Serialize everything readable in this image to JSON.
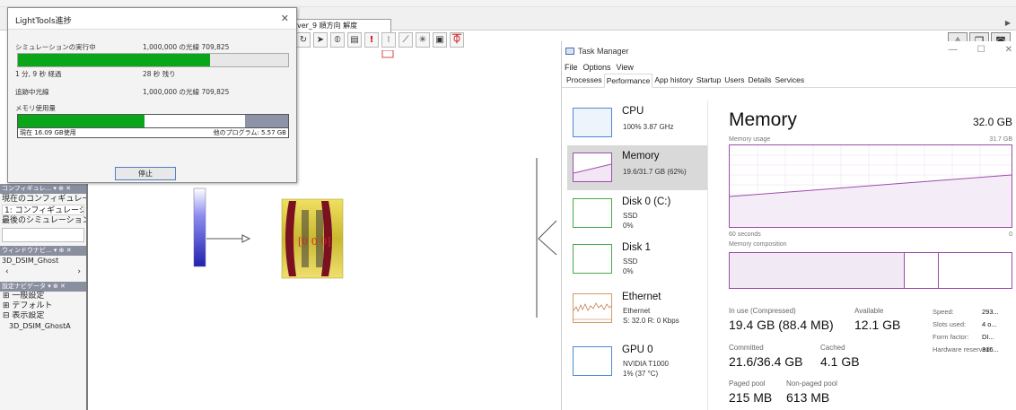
{
  "lighttools": {
    "document_tab": "ver_9 順方向 解度",
    "left_panel": {
      "config_header": "コンフィギュレ... ▾ ⊕ ✕",
      "current_config_label": "現在のコンフィギュレー",
      "config_select": "1: コンフィギュレーシ",
      "last_sim_label": "最後のシミュレーション",
      "window_header": "ウィンドウナビ... ▾ ⊕ ✕",
      "window_item": "3D_DSIM_Ghost",
      "settings_header": "設定ナビゲータ ▾ ⊕ ✕",
      "tree": [
        "⊞ 一般設定",
        "⊞ デフォルト",
        "⊟ 表示設定",
        "3D_DSIM_GhostA"
      ]
    },
    "canvas": {
      "lens_label": "[0 0 0]"
    }
  },
  "progress_dialog": {
    "title": "LightTools進捗",
    "close": "✕",
    "sim_label": "シミュレーションの実行中",
    "sim_value": "1,000,000 の光線 709,825",
    "sim_progress": 0.71,
    "elapsed": "1 分, 9 秒 経過",
    "remaining": "28 秒 残り",
    "traced_label": "追跡中光線",
    "traced_value": "1,000,000 の光線 709,825",
    "memory_label": "メモリ使用量",
    "memory_used_fraction": 0.47,
    "memory_other_fraction": 0.16,
    "memory_current": "現在 16.09 GB使用",
    "memory_other": "他のプログラム: 5.57 GB",
    "stop_button": "停止"
  },
  "task_manager": {
    "title": "Task Manager",
    "window_controls": [
      "—",
      "☐",
      "✕"
    ],
    "menu": [
      "File",
      "Options",
      "View"
    ],
    "tabs": [
      "Processes",
      "Performance",
      "App history",
      "Startup",
      "Users",
      "Details",
      "Services"
    ],
    "active_tab": "Performance",
    "resources": [
      {
        "name": "CPU",
        "line1": "100% 3.87 GHz",
        "line2": "",
        "color": "#4a8ad4"
      },
      {
        "name": "Memory",
        "line1": "19.6/31.7 GB (62%)",
        "line2": "",
        "color": "#9c4dab"
      },
      {
        "name": "Disk 0 (C:)",
        "line1": "SSD",
        "line2": "0%",
        "color": "#4aa84a"
      },
      {
        "name": "Disk 1",
        "line1": "SSD",
        "line2": "0%",
        "color": "#4aa84a"
      },
      {
        "name": "Ethernet",
        "line1": "Ethernet",
        "line2": "S: 32.0 R: 0 Kbps",
        "color": "#b5651d"
      },
      {
        "name": "GPU 0",
        "line1": "NVIDIA T1000",
        "line2": "1% (37 °C)",
        "color": "#4a8ad4"
      }
    ],
    "memory": {
      "heading": "Memory",
      "total": "32.0 GB",
      "usage_label": "Memory usage",
      "usage_max": "31.7 GB",
      "axis_left": "60 seconds",
      "axis_right": "0",
      "composition_label": "Memory composition",
      "in_use_label": "In use (Compressed)",
      "in_use_value": "19.4 GB (88.4 MB)",
      "available_label": "Available",
      "available_value": "12.1 GB",
      "committed_label": "Committed",
      "committed_value": "21.6/36.4 GB",
      "cached_label": "Cached",
      "cached_value": "4.1 GB",
      "paged_label": "Paged pool",
      "paged_value": "215 MB",
      "nonpaged_label": "Non-paged pool",
      "nonpaged_value": "613 MB",
      "speed_label": "Speed:",
      "speed_value": "293...",
      "slots_label": "Slots used:",
      "slots_value": "4 o...",
      "form_label": "Form factor:",
      "form_value": "DI...",
      "reserved_label": "Hardware reserved:",
      "reserved_value": "316..."
    }
  }
}
